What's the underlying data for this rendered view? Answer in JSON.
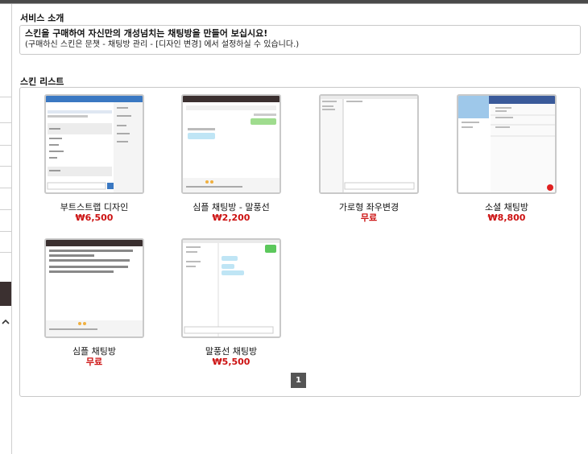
{
  "intro": {
    "title": "서비스 소개",
    "line1": "스킨을 구매하여 자신만의 개성넘치는 채팅방을 만들어 보십시요!",
    "line2": "(구매하신 스킨은 문챗 - 채팅방 관리 - [디자인 변경] 에서 설정하실 수 있습니다.)"
  },
  "skins": {
    "title": "스킨 리스트",
    "items": [
      {
        "name": "부트스트랩 디자인",
        "price": "₩6,500"
      },
      {
        "name": "심플 채팅방 - 말풍선",
        "price": "₩2,200"
      },
      {
        "name": "가로형 좌우변경",
        "price": "무료"
      },
      {
        "name": "소셜 채팅방",
        "price": "₩8,800"
      },
      {
        "name": "심플 채팅방",
        "price": "무료"
      },
      {
        "name": "말풍선 채팅방",
        "price": "₩5,500"
      }
    ]
  },
  "pagination": {
    "current": "1"
  },
  "icons": {
    "nav_toggle": "chevron-up-icon"
  },
  "colors": {
    "price": "#cc1111",
    "pager": "#555555",
    "active_nav": "#3b3030"
  }
}
